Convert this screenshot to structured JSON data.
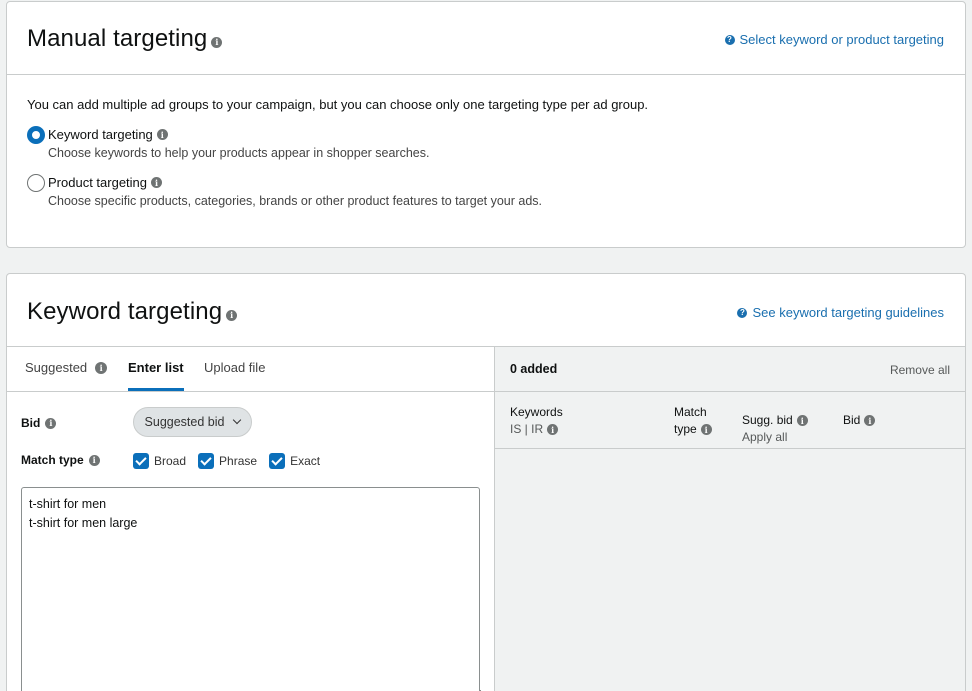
{
  "manual": {
    "title": "Manual targeting",
    "help_link": "Select keyword or product targeting",
    "intro": "You can add multiple ad groups to your campaign, but you can choose only one targeting type per ad group.",
    "options": [
      {
        "label": "Keyword targeting",
        "desc": "Choose keywords to help your products appear in shopper searches.",
        "selected": true
      },
      {
        "label": "Product targeting",
        "desc": "Choose specific products, categories, brands or other product features to target your ads.",
        "selected": false
      }
    ]
  },
  "keyword": {
    "title": "Keyword targeting",
    "help_link": "See keyword targeting guidelines",
    "tabs": [
      {
        "label": "Suggested",
        "active": false
      },
      {
        "label": "Enter list",
        "active": true
      },
      {
        "label": "Upload file",
        "active": false
      }
    ],
    "bid_label": "Bid",
    "bid_button": "Suggested bid",
    "match_type_label": "Match type",
    "match_types": [
      "Broad",
      "Phrase",
      "Exact"
    ],
    "keywords_text": "t-shirt for men\nt-shirt for men large",
    "added_count": "0 added",
    "remove_all": "Remove all",
    "columns": {
      "keywords": "Keywords",
      "keywords_sub": "IS | IR",
      "match_line1": "Match",
      "match_line2": "type",
      "sugg_bid": "Sugg. bid",
      "apply_all": "Apply all",
      "bid": "Bid"
    }
  },
  "colors": {
    "accent": "#0b6fba",
    "link": "#1a6faf",
    "border": "#c9cccc"
  }
}
